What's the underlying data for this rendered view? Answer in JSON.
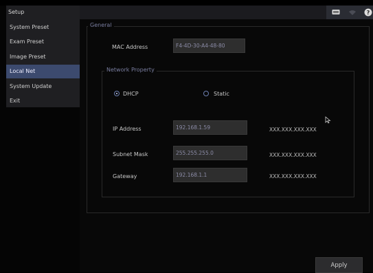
{
  "sidebar": {
    "title": "Setup",
    "items": [
      {
        "label": "System Preset"
      },
      {
        "label": "Exam Preset"
      },
      {
        "label": "Image Preset"
      },
      {
        "label": "Local Net"
      },
      {
        "label": "System  Update"
      },
      {
        "label": "Exit"
      }
    ],
    "active_index": 3
  },
  "toolbar": {
    "icons": [
      "keyboard-icon",
      "network-icon",
      "help-icon"
    ]
  },
  "general": {
    "legend": "General",
    "mac_label": "MAC Address",
    "mac_value": "F4-4D-30-A4-48-80"
  },
  "network": {
    "legend": "Network Property",
    "dhcp_label": "DHCP",
    "static_label": "Static",
    "selected_mode": "DHCP",
    "ip_label": "IP Address",
    "ip_value": "192.168.1.59",
    "ip_hint": "XXX.XXX.XXX.XXX",
    "mask_label": "Subnet Mask",
    "mask_value": "255.255.255.0",
    "mask_hint": "XXX.XXX.XXX.XXX",
    "gateway_label": "Gateway",
    "gateway_value": "192.168.1.1",
    "gateway_hint": "XXX.XXX.XXX.XXX"
  },
  "actions": {
    "apply_label": "Apply"
  },
  "colors": {
    "active_item": "#3c4a6e",
    "panel_border": "#2a2a2a"
  }
}
